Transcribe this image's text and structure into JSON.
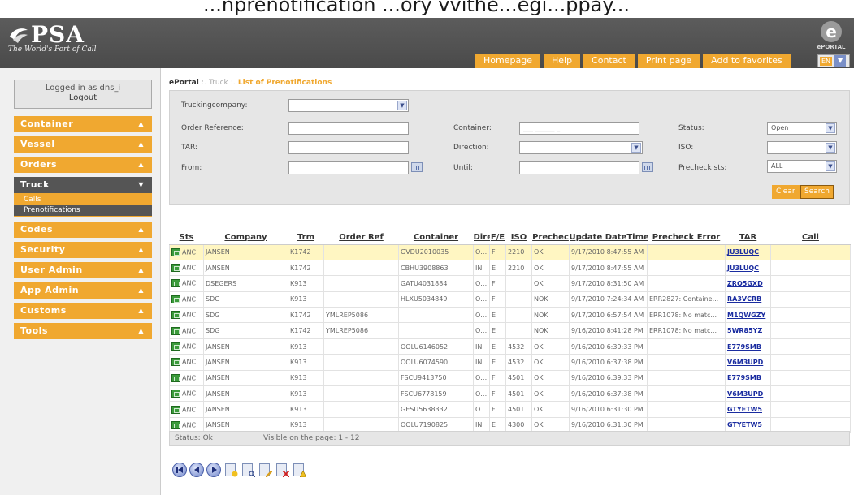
{
  "caption_fragment": "...nprenotification ...ory vvithe...egi...ppay...",
  "header": {
    "logo_text": "PSA",
    "tagline": "The World's Port of Call",
    "eportal_label": "ePORTAL",
    "nav": [
      "Homepage",
      "Help",
      "Contact",
      "Print page",
      "Add to favorites"
    ],
    "language": "EN"
  },
  "sidebar": {
    "logged_in": "Logged in as dns_i",
    "logout": "Logout",
    "menu": [
      {
        "label": "Container"
      },
      {
        "label": "Vessel"
      },
      {
        "label": "Orders"
      },
      {
        "label": "Truck",
        "open": true,
        "sub": [
          "Calls",
          "Prenotifications"
        ]
      },
      {
        "label": "Codes"
      },
      {
        "label": "Security"
      },
      {
        "label": "User Admin"
      },
      {
        "label": "App Admin"
      },
      {
        "label": "Customs"
      },
      {
        "label": "Tools"
      }
    ]
  },
  "breadcrumb": {
    "root": "ePortal",
    "sep": ":.",
    "mid": "Truck",
    "current": "List of Prenotifications"
  },
  "filters": {
    "truckingcompany_label": "Truckingcompany:",
    "truckingcompany_value": "",
    "order_ref_label": "Order Reference:",
    "order_ref_value": "",
    "container_label": "Container:",
    "container_value": "___ ______ _",
    "status_label": "Status:",
    "status_value": "Open",
    "tar_label": "TAR:",
    "tar_value": "",
    "direction_label": "Direction:",
    "direction_value": "",
    "iso_label": "ISO:",
    "iso_value": "",
    "from_label": "From:",
    "from_value": "",
    "until_label": "Until:",
    "until_value": "",
    "precheck_label": "Precheck sts:",
    "precheck_value": "ALL",
    "clear": "Clear",
    "search": "Search"
  },
  "table": {
    "columns": [
      "Sts",
      "Company",
      "Trm",
      "Order Ref",
      "Container",
      "Dire",
      "F/E",
      "ISO",
      "Prechec",
      "Update DateTime",
      "Precheck Error",
      "TAR",
      "Call"
    ],
    "rows": [
      [
        "ANC",
        "JANSEN",
        "K1742",
        "",
        "GVDU2010035",
        "OUT",
        "F",
        "2210",
        "OK",
        "9/17/2010 8:47:55 AM",
        "",
        "JU3LUQC",
        ""
      ],
      [
        "ANC",
        "JANSEN",
        "K1742",
        "",
        "CBHU3908863",
        "IN",
        "E",
        "2210",
        "OK",
        "9/17/2010 8:47:55 AM",
        "",
        "JU3LUQC",
        ""
      ],
      [
        "ANC",
        "DSEGERS",
        "K913",
        "",
        "GATU4031884",
        "OUT",
        "F",
        "",
        "OK",
        "9/17/2010 8:31:50 AM",
        "",
        "ZRQ5GXD",
        ""
      ],
      [
        "ANC",
        "SDG",
        "K913",
        "",
        "HLXU5034849",
        "OUT",
        "F",
        "",
        "NOK",
        "9/17/2010 7:24:34 AM",
        "ERR2827: Containe...",
        "RA3VCRB",
        ""
      ],
      [
        "ANC",
        "SDG",
        "K1742",
        "YMLREP5086",
        "",
        "OUT",
        "E",
        "",
        "NOK",
        "9/17/2010 6:57:54 AM",
        "ERR1078: No matc...",
        "M1QWGZY",
        ""
      ],
      [
        "ANC",
        "SDG",
        "K1742",
        "YMLREP5086",
        "",
        "OUT",
        "E",
        "",
        "NOK",
        "9/16/2010 8:41:28 PM",
        "ERR1078: No matc...",
        "5WR85YZ",
        ""
      ],
      [
        "ANC",
        "JANSEN",
        "K913",
        "",
        "OOLU6146052",
        "IN",
        "E",
        "4532",
        "OK",
        "9/16/2010 6:39:33 PM",
        "",
        "E779SMB",
        ""
      ],
      [
        "ANC",
        "JANSEN",
        "K913",
        "",
        "OOLU6074590",
        "IN",
        "E",
        "4532",
        "OK",
        "9/16/2010 6:37:38 PM",
        "",
        "V6M3UPD",
        ""
      ],
      [
        "ANC",
        "JANSEN",
        "K913",
        "",
        "FSCU9413750",
        "OUT",
        "F",
        "4501",
        "OK",
        "9/16/2010 6:39:33 PM",
        "",
        "E779SMB",
        ""
      ],
      [
        "ANC",
        "JANSEN",
        "K913",
        "",
        "FSCU6778159",
        "OUT",
        "F",
        "4501",
        "OK",
        "9/16/2010 6:37:38 PM",
        "",
        "V6M3UPD",
        ""
      ],
      [
        "ANC",
        "JANSEN",
        "K913",
        "",
        "GESU5638332",
        "OUT",
        "F",
        "4501",
        "OK",
        "9/16/2010 6:31:30 PM",
        "",
        "GTYETW5",
        ""
      ],
      [
        "ANC",
        "JANSEN",
        "K913",
        "",
        "OOLU7190825",
        "IN",
        "E",
        "4300",
        "OK",
        "9/16/2010 6:31:30 PM",
        "",
        "GTYETW5",
        ""
      ]
    ]
  },
  "status_bar": {
    "status": "Status: Ok",
    "visible": "Visible on the page: 1 - 12"
  },
  "colors": {
    "accent": "#f0a830",
    "header": "#555555",
    "selected_row": "#fff6c2",
    "link": "#1a2ca0"
  }
}
